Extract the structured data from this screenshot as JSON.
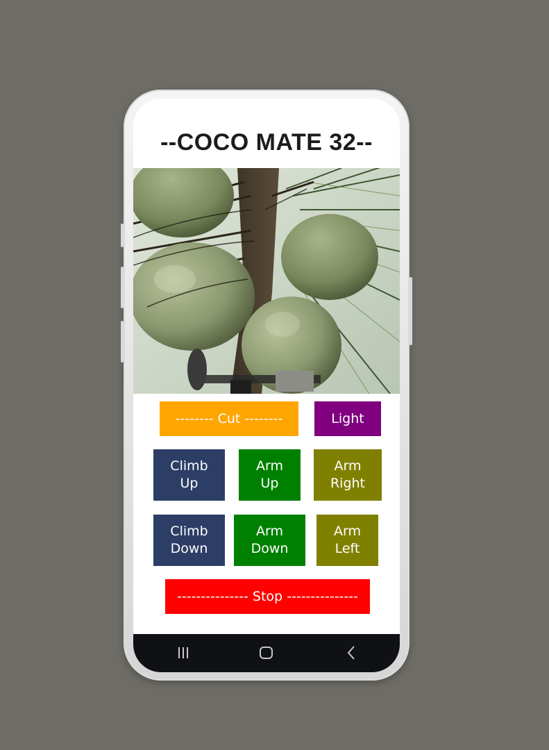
{
  "app": {
    "title": "--COCO MATE 32--"
  },
  "camera": {
    "alt": "Live camera feed of coconut cluster"
  },
  "buttons": {
    "cut": "-------- Cut --------",
    "light": "Light",
    "climb_up": "Climb\nUp",
    "arm_up": "Arm\nUp",
    "arm_right": "Arm\nRight",
    "climb_down": "Climb\nDown",
    "arm_down": "Arm\nDown",
    "arm_left": "Arm\nLeft",
    "stop": "--------------- Stop ---------------"
  },
  "colors": {
    "cut": "#ffa500",
    "light": "#800080",
    "climb": "#2c3e66",
    "arm_vertical": "#008000",
    "arm_horizontal": "#808000",
    "stop": "#ff0000"
  },
  "navbar": {
    "icons": [
      "recent-apps-icon",
      "home-icon",
      "back-icon"
    ]
  }
}
